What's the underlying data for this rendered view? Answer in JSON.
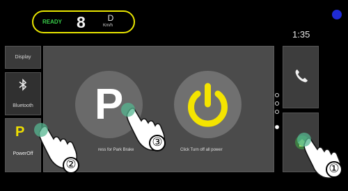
{
  "status": {
    "ready": "READY",
    "gear": "8",
    "drive": "D",
    "unit": "Km/h",
    "time": "1:35"
  },
  "sidebar": {
    "items": [
      {
        "label": "Display",
        "icon": "display-icon"
      },
      {
        "label": "Bluetooth",
        "icon": "bluetooth-icon"
      },
      {
        "label": "PowerOff",
        "icon": "parking-icon"
      }
    ]
  },
  "main": {
    "park_letter": "P",
    "park_caption": "ress for Park Brake",
    "power_caption": "Click Turn off all power"
  },
  "pager": {
    "count": 4,
    "active": 4
  },
  "right": {
    "phone_icon": "phone-icon",
    "home_icon": "home-icon"
  },
  "steps": [
    "①",
    "②",
    "③"
  ],
  "colors": {
    "accent_yellow": "#e9e600",
    "ready_green": "#39d04a",
    "touch_green": "#55b590",
    "panel_gray": "#4b4b4b"
  }
}
